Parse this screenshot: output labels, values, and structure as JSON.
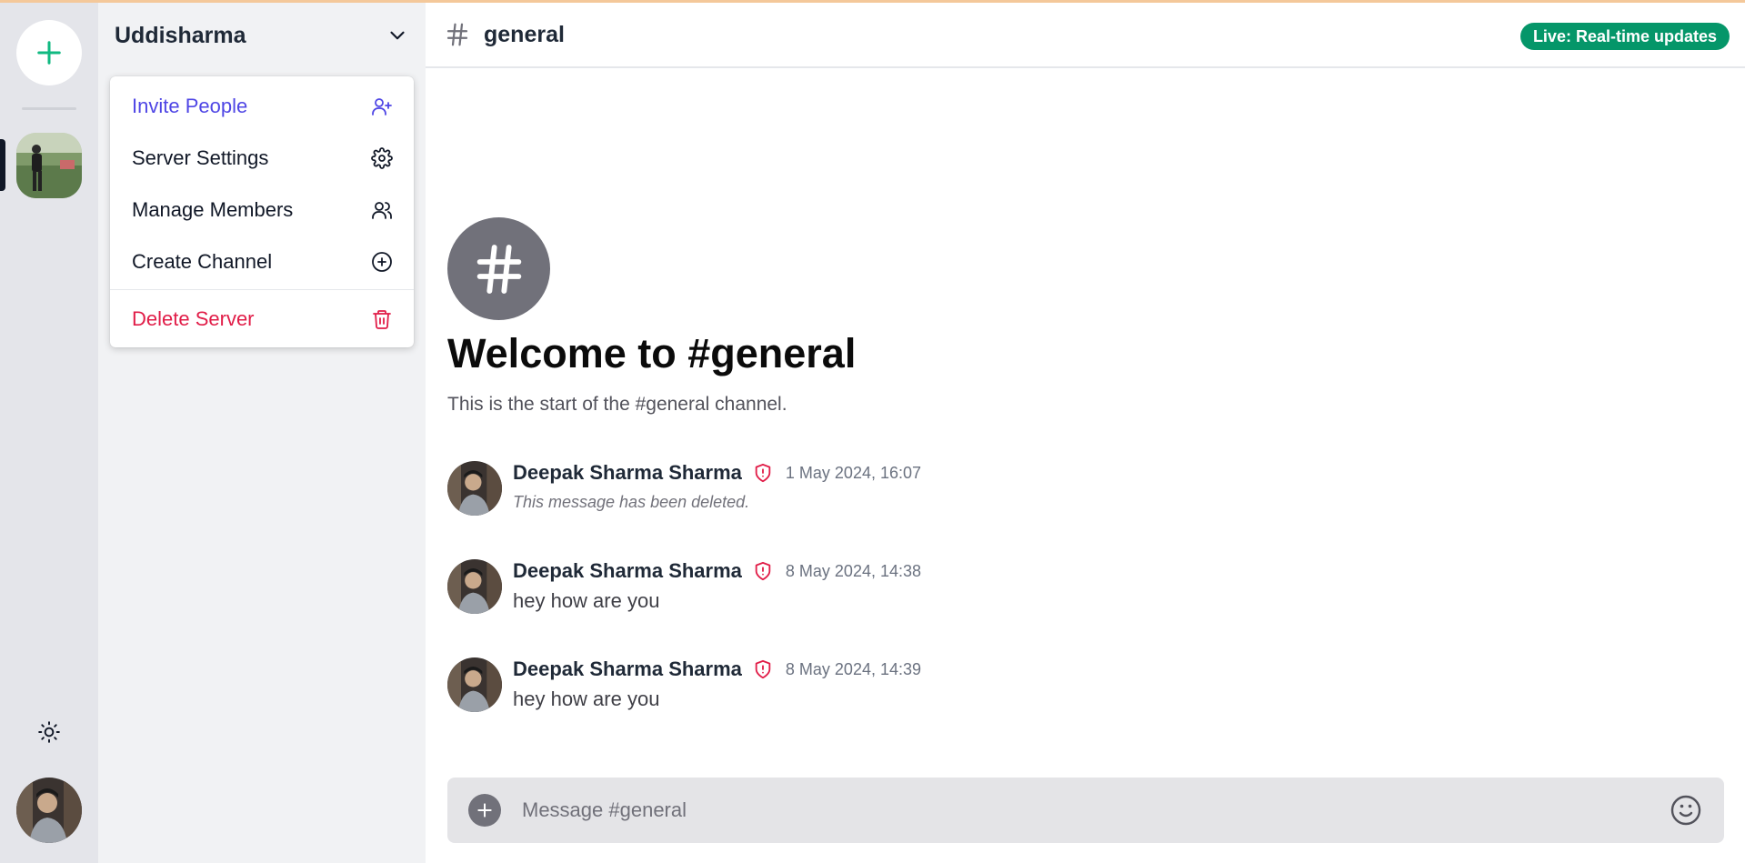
{
  "server": {
    "name": "Uddisharma"
  },
  "menu": {
    "invite": "Invite People",
    "settings": "Server Settings",
    "members": "Manage Members",
    "create_channel": "Create Channel",
    "delete": "Delete Server"
  },
  "channel": {
    "name": "general",
    "welcome_title": "Welcome to #general",
    "welcome_subtitle": "This is the start of the #general channel.",
    "live_badge": "Live: Real-time updates"
  },
  "messages": [
    {
      "author": "Deepak Sharma Sharma",
      "time": "1 May 2024, 16:07",
      "body": "This message has been deleted.",
      "deleted": true,
      "role_icon": "shield-alert-icon"
    },
    {
      "author": "Deepak Sharma Sharma",
      "time": "8 May 2024, 14:38",
      "body": "hey how are you",
      "deleted": false,
      "role_icon": "shield-alert-icon"
    },
    {
      "author": "Deepak Sharma Sharma",
      "time": "8 May 2024, 14:39",
      "body": "hey how are you",
      "deleted": false,
      "role_icon": "shield-alert-icon"
    }
  ],
  "composer": {
    "placeholder": "Message #general",
    "value": ""
  },
  "colors": {
    "accent": "#4f46e5",
    "danger": "#e11d48",
    "live": "#059669",
    "add_server": "#10b981"
  },
  "icons": {
    "add_server": "plus-icon",
    "theme": "sun-icon",
    "dropdown": "chevron-down-icon",
    "invite": "user-plus-icon",
    "settings": "gear-icon",
    "members": "users-icon",
    "create": "plus-circle-icon",
    "delete": "trash-icon",
    "channel": "hash-icon",
    "emoji": "smile-icon"
  }
}
